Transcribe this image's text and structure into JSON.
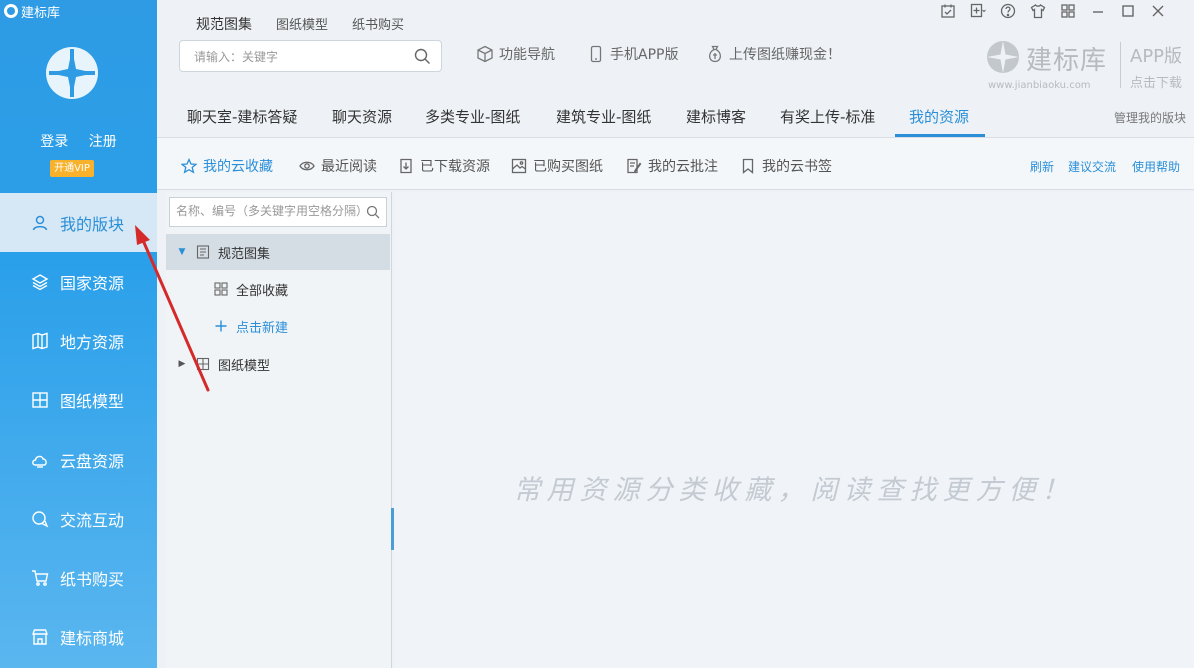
{
  "app": {
    "title": "建标库"
  },
  "sidebar": {
    "login": "登录",
    "register": "注册",
    "vip": "开通VIP",
    "items": [
      {
        "label": "我的版块",
        "icon": "user-icon",
        "active": true
      },
      {
        "label": "国家资源",
        "icon": "layers-icon",
        "active": false
      },
      {
        "label": "地方资源",
        "icon": "map-icon",
        "active": false
      },
      {
        "label": "图纸模型",
        "icon": "blueprint-icon",
        "active": false
      },
      {
        "label": "云盘资源",
        "icon": "cloud-drive-icon",
        "active": false
      },
      {
        "label": "交流互动",
        "icon": "chat-icon",
        "active": false
      },
      {
        "label": "纸书购买",
        "icon": "cart-icon",
        "active": false
      },
      {
        "label": "建标商城",
        "icon": "store-icon",
        "active": false
      }
    ]
  },
  "top_tabs": [
    {
      "label": "规范图集",
      "active": true
    },
    {
      "label": "图纸模型",
      "active": false
    },
    {
      "label": "纸书购买",
      "active": false
    }
  ],
  "search": {
    "placeholder": "请输入：关键字"
  },
  "top_links": [
    {
      "label": "功能导航",
      "icon": "cube-icon"
    },
    {
      "label": "手机APP版",
      "icon": "phone-icon"
    },
    {
      "label": "上传图纸赚现金！",
      "icon": "money-bag-icon"
    }
  ],
  "brand": {
    "name": "建标库",
    "url": "www.jianbiaoku.com",
    "app": "APP版",
    "download": "点击下载"
  },
  "main_tabs": [
    {
      "label": "聊天室-建标答疑",
      "active": false
    },
    {
      "label": "聊天资源",
      "active": false
    },
    {
      "label": "多类专业-图纸",
      "active": false
    },
    {
      "label": "建筑专业-图纸",
      "active": false
    },
    {
      "label": "建标博客",
      "active": false
    },
    {
      "label": "有奖上传-标准",
      "active": false
    },
    {
      "label": "我的资源",
      "active": true
    }
  ],
  "manage_label": "管理我的版块",
  "sub_tools": [
    {
      "label": "我的云收藏",
      "icon": "star-icon",
      "active": true
    },
    {
      "label": "最近阅读",
      "icon": "eye-icon",
      "active": false
    },
    {
      "label": "已下载资源",
      "icon": "download-icon",
      "active": false
    },
    {
      "label": "已购买图纸",
      "icon": "image-icon",
      "active": false
    },
    {
      "label": "我的云批注",
      "icon": "annotate-icon",
      "active": false
    },
    {
      "label": "我的云书签",
      "icon": "bookmark-icon",
      "active": false
    }
  ],
  "right_links": {
    "refresh": "刷新",
    "feedback": "建议交流",
    "help": "使用帮助"
  },
  "tree": {
    "search_placeholder": "名称、编号（多关键字用空格分隔）",
    "nodes": [
      {
        "label": "规范图集",
        "level": 0,
        "expanded": true,
        "selected": true
      },
      {
        "label": "全部收藏",
        "level": 1
      },
      {
        "label": "点击新建",
        "level": 1
      },
      {
        "label": "图纸模型",
        "level": 0,
        "expanded": false
      }
    ]
  },
  "content": {
    "empty_message": "常用资源分类收藏，阅读查找更方便！"
  },
  "colors": {
    "accent": "#2b8fd8",
    "sidebar": "#2e9be4",
    "vip": "#f7b12a",
    "arrow": "#d42a2a"
  }
}
